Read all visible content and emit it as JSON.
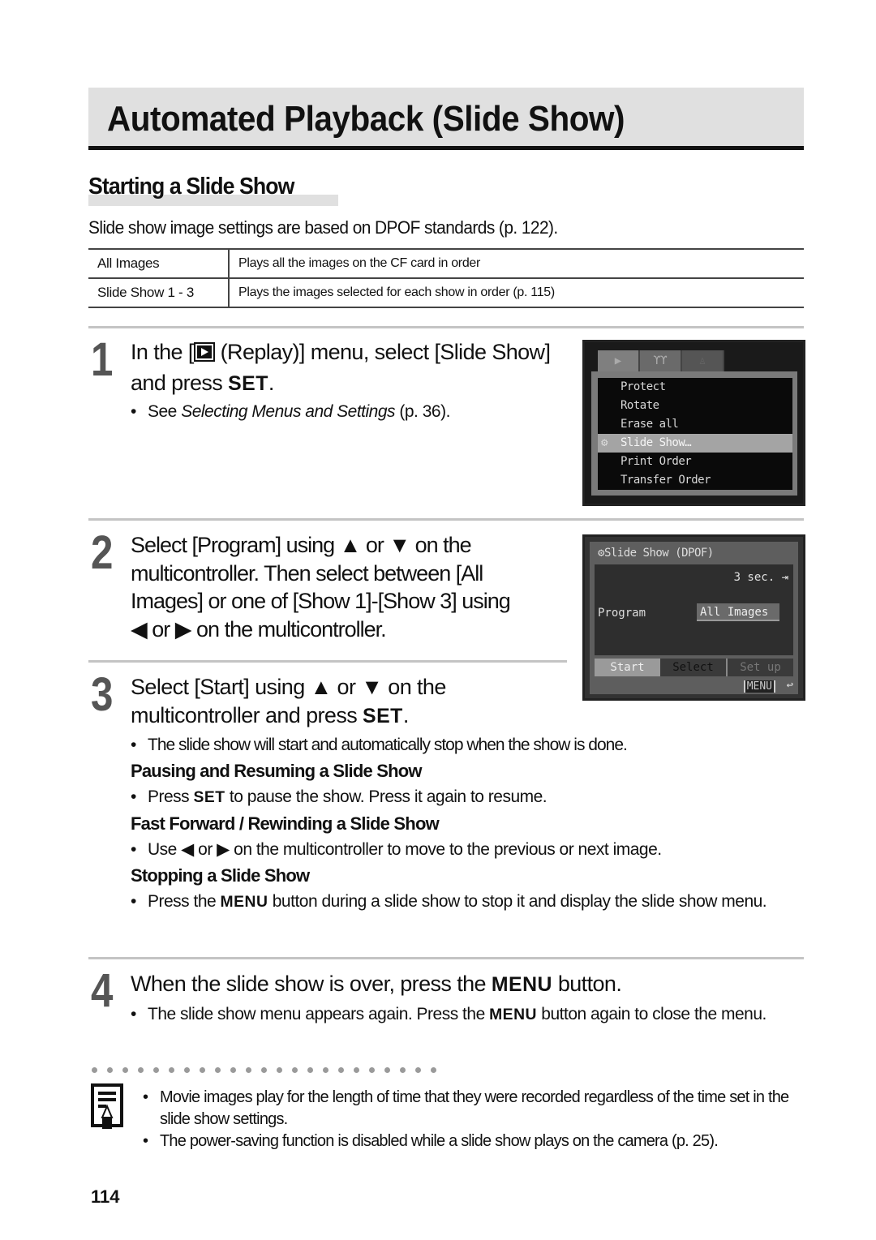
{
  "title": "Automated Playback (Slide Show)",
  "section_heading": "Starting a Slide Show",
  "intro": "Slide show image settings are based on DPOF standards (p. 122).",
  "table": {
    "rows": [
      {
        "program": "All Images",
        "description": "Plays all the images on the CF card in order"
      },
      {
        "program": "Slide Show 1 - 3",
        "description": "Plays the images selected for each show in order (p. 115)"
      }
    ]
  },
  "steps": [
    {
      "number": "1",
      "text_before_icon": "In the [",
      "text_after_icon": " (Replay)] menu, select [Slide Show] and press ",
      "key": "SET",
      "text_end": ".",
      "bullet_prefix": "See ",
      "bullet_italic": "Selecting Menus and Settings",
      "bullet_suffix": " (p. 36)."
    },
    {
      "number": "2",
      "line1": "Select [Program] using ▲ or ▼ on the",
      "line2": "multicontroller. Then select between [All",
      "line3": "Images] or one of [Show 1]-[Show 3] using",
      "line4": "◀ or ▶ on the multicontroller."
    },
    {
      "number": "3",
      "line1": "Select [Start] using ▲ or ▼ on the",
      "line2_prefix": "multicontroller and press ",
      "key": "SET",
      "line2_end": ".",
      "bullet": "The slide show will start and automatically stop when the show is done.",
      "subsections": [
        {
          "heading": "Pausing and Resuming a Slide Show",
          "bullet_prefix": "Press ",
          "key": "SET",
          "bullet_suffix": " to pause the show. Press it again to resume."
        },
        {
          "heading": "Fast Forward / Rewinding a Slide Show",
          "bullet_prefix": "Use ◀ or ▶ on the multicontroller to move to the previous or next image.",
          "key": "",
          "bullet_suffix": ""
        },
        {
          "heading": "Stopping a Slide Show",
          "bullet_prefix": "Press the ",
          "key": "MENU",
          "bullet_suffix": " button during a slide show to stop it and display the slide show menu."
        }
      ]
    },
    {
      "number": "4",
      "text_prefix": "When the slide show is over, press the ",
      "key": "MENU",
      "text_suffix": " button.",
      "bullet_prefix": "The slide show menu appears again. Press the ",
      "bullet_key": "MENU",
      "bullet_suffix": " button again to close the menu."
    }
  ],
  "camera_screen_1": {
    "tabs": [
      "▶",
      "ϒϒ",
      "♙"
    ],
    "items": [
      "Protect",
      "Rotate",
      "Erase all",
      "Slide Show…",
      "Print Order",
      "Transfer Order"
    ],
    "selected_index": 3
  },
  "camera_screen_2": {
    "header": "Slide Show (DPOF)",
    "interval": "3 sec. ⇥",
    "program_label": "Program",
    "program_value": "All Images",
    "buttons": [
      "Start",
      "Select",
      "Set up"
    ],
    "menu_tag": "MENU",
    "return_glyph": "↩"
  },
  "notes": [
    "Movie images play for the length of time that they were recorded regardless of the time set in the slide show settings.",
    "The power-saving function is disabled while a slide show plays on the camera (p. 25)."
  ],
  "page_number": "114"
}
